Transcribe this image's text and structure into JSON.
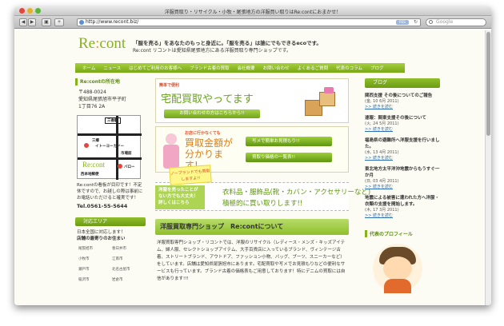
{
  "window": {
    "title": "洋服買取り・リサイクル・小牧・尾張地方の洋服買い取りはRe:contにおまかせ！",
    "url": "http://www.recont.biz/",
    "rss_label": "RSS",
    "search_placeholder": "Google"
  },
  "header": {
    "logo_main": "Re",
    "logo_mark": ":",
    "logo_rest": "cont",
    "tagline1": "「服を売る」をあなたのもっと身近に。「服を売る」は誰にでもできるecoです。",
    "tagline2": "Re:cont リコントは愛知県尾張地方にある洋服買取り専門ショップです。"
  },
  "nav": [
    "ホーム",
    "ニュース",
    "はじめてご利用のお客様へ",
    "ブランド古着の買取",
    "会社概要",
    "お問い合わせ",
    "よくあるご質問",
    "代表のコラム",
    "ブログ"
  ],
  "left": {
    "shop_title": "Re:contの所在地",
    "address": [
      "〒488-0024",
      "愛知県尾張旭市平子町",
      "1丁目76 2A"
    ],
    "map_labels": {
      "sanbashi": "三香駅",
      "yoko": "イトーヨーカドー",
      "kaido": "三郷",
      "ichiba": "市場前",
      "ballo": "バロー",
      "nishi": "西本地郵便"
    },
    "map_logo": "Re:cont",
    "note": "Re:contの看板が目印です！不定休ですので、お越しの際は事前にお電話いただけると確実です！",
    "tel": "Tel.0561-55-5644",
    "area_title": "対応エリア",
    "area_text1": "日本全国に対応します！",
    "area_text2": "店舗の最寄りのお住まい",
    "area_cells": [
      "尾張旭市",
      "春日井市",
      "小牧市",
      "江南市",
      "瀬戸市",
      "北名古屋市",
      "稲沢市",
      "岩倉市"
    ]
  },
  "center": {
    "banner1_kicker": "簡単で便利",
    "banner1_title": "宅配買取やってます",
    "banner1_button": "お問い合わせの方はこちらから!!",
    "banner2_kicker": "お店に行かなくても",
    "banner2_title": "買取金額が分かります!",
    "banner2_button1": "写メで簡単お見積もり!!",
    "banner2_button2": "買取り価格の一覧表!!",
    "badge": "ノーブランドでも買取しますよ!!",
    "banner3_left": "洋服を売ったことがない方でも大丈夫！詳しくはこちら",
    "banner3_right1": "衣料品・服飾品(靴・カバン・アクセサリーなど)",
    "banner3_right2": "積極的に買い取りします!!",
    "about_title": "洋服買取専門ショップ　Re:contについて",
    "about_text": "洋服買取専門ショップ・リコントでは、洋服のリサイクル（レディース・メンズ・キッズアイテム、婦人服、セレクトショップアイテム、大手百貨店に入っているブランド、ヴィンテージ古着、ストリートブランド、アウトドア、ファッション小物、バッグ、ブーツ、スニーカーなど）をしています。店舗は愛知県尾張旭市にあります。宅配買取や写メでお見積もりなどの便利なサービスも行っています。ブランド古着の価格表もご用意しております！特にデニムの買取には自信があります!!!"
  },
  "right": {
    "blog_title": "ブログ",
    "posts": [
      {
        "title": "関西支援 その後についてのご報告",
        "date": "(金, 10 6月 2011)",
        "more": ">> 続きを読む"
      },
      {
        "title": "速報：関東支援その後について",
        "date": "(火, 24 5月 2011)",
        "more": ">> 続きを読む"
      },
      {
        "title": "福島県の避難所へ洋服支援を行いました。",
        "date": "(水, 13 4月 2011)",
        "more": ">> 続きを読む"
      },
      {
        "title": "東北地方太平洋沖地震からもうすぐ一か月",
        "date": "(日, 03 4月 2011)",
        "more": ">> 続きを読む"
      },
      {
        "title": "地震による被害に遭われた方へ洋服・衣類の支援を開始します。",
        "date": "(木, 17 3月 2011)",
        "more": ">> 続きを読む"
      }
    ],
    "profile_title": "代表のプロフィール"
  }
}
